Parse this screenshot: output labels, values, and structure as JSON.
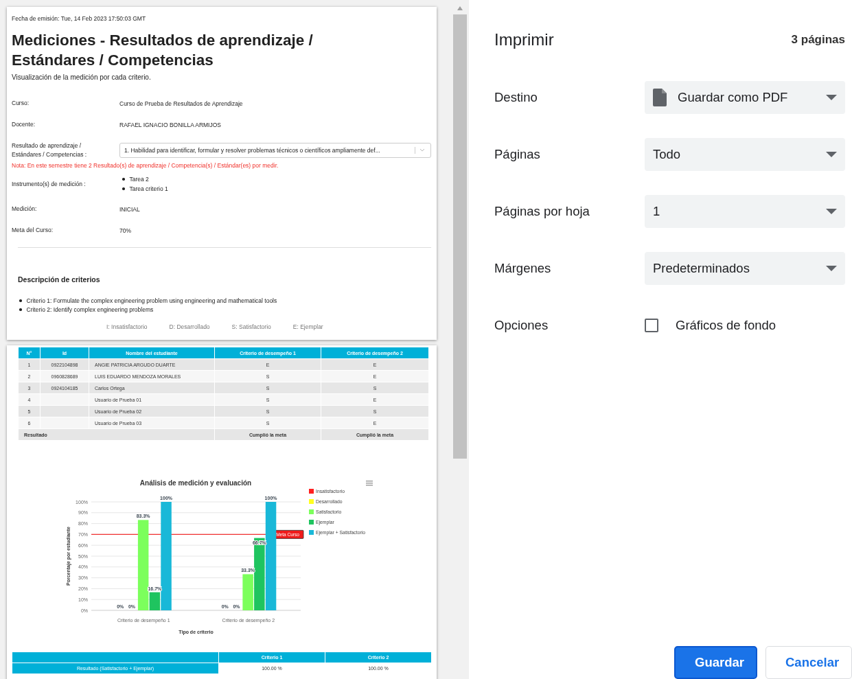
{
  "preview": {
    "page_1": {
      "issue_date": "Fecha de emisión: Tue, 14 Feb 2023 17:50:03 GMT",
      "title": "Mediciones - Resultados de aprendizaje / Estándares / Competencias",
      "subtitle": "Visualización de la medición por cada criterio.",
      "fields": [
        {
          "kind": "text",
          "label": "Curso:",
          "value": "Curso de Prueba de Resultados de Aprendizaje"
        },
        {
          "kind": "text",
          "label": "Docente:",
          "value": "RAFAEL IGNACIO BONILLA ARMIJOS"
        },
        {
          "kind": "select",
          "label": "Resultado de aprendizaje / Estándares / Competencias :",
          "value": "1. Habilidad para identificar, formular y resolver problemas técnicos o científicos ampliamente def..."
        },
        {
          "kind": "note",
          "text": "Nota: En este semestre tiene 2 Resultado(s) de aprendizaje / Competencia(s) / Estándar(es) por medir."
        },
        {
          "kind": "list",
          "label": "Instrumento(s) de medición :",
          "items": [
            "Tarea 2",
            "Tarea criterio 1"
          ]
        },
        {
          "kind": "text",
          "label": "Medición:",
          "value": "INICIAL"
        },
        {
          "kind": "text",
          "label": "Meta del Curso:",
          "value": "70%"
        }
      ],
      "criteria_heading": "Descripción de criterios",
      "criteria": [
        "Criterio 1: Formulate the complex engineering problem using engineering and mathematical tools",
        "Criterio 2: Identify complex engineering problems"
      ],
      "legend": [
        "I: Insatisfactorio",
        "D: Desarrollado",
        "S: Satisfactorio",
        "E: Ejemplar"
      ]
    },
    "page_2": {
      "table": {
        "columns": [
          "N°",
          "Id",
          "Nombre del estudiante",
          "Criterio de desempeño 1",
          "Criterio de desempeño 2"
        ],
        "rows": [
          {
            "cells": [
              "1",
              "0922104898",
              "ANGIE PATRICIA ARGUDO DUARTE",
              "E",
              "E"
            ]
          },
          {
            "cells": [
              "2",
              "0960828689",
              "LUIS EDUARDO MENDOZA MORALES",
              "S",
              "E"
            ]
          },
          {
            "cells": [
              "3",
              "0924104185",
              "Carlos Ortega",
              "S",
              "S"
            ]
          },
          {
            "cells": [
              "4",
              "",
              "Usuario de Prueba 01",
              "S",
              "E"
            ]
          },
          {
            "cells": [
              "5",
              "",
              "Usuario de Prueba 02",
              "S",
              "S"
            ]
          },
          {
            "cells": [
              "6",
              "",
              "Usuario de Prueba 03",
              "S",
              "E"
            ]
          }
        ],
        "footer": [
          "Resultado",
          "Cumplió la meta",
          "Cumplió la meta"
        ]
      },
      "chart_data": {
        "type": "bar",
        "title": "Análisis de medición y evaluación",
        "xlabel": "Tipo de criterio",
        "ylabel": "Porcentaje por estudiante",
        "categories": [
          "Criterio de desempeño 1",
          "Criterio de desempeño 2"
        ],
        "series": [
          {
            "name": "Insatisfactorio",
            "color": "#ff2020",
            "values": [
              0,
              0
            ]
          },
          {
            "name": "Desarrollado",
            "color": "#ffff20",
            "values": [
              0,
              0
            ]
          },
          {
            "name": "Satisfactorio",
            "color": "#7cff5c",
            "values": [
              83.3,
              33.3
            ]
          },
          {
            "name": "Ejemplar",
            "color": "#1fc45f",
            "values": [
              16.7,
              66.7
            ]
          },
          {
            "name": "Ejemplar + Satisfactorio",
            "color": "#19b8d8",
            "values": [
              100,
              100
            ]
          }
        ],
        "ylim": [
          0,
          100
        ],
        "yticks": [
          {
            "value": 0,
            "label": "0%"
          },
          {
            "value": 10,
            "label": "10%"
          },
          {
            "value": 20,
            "label": "20%"
          },
          {
            "value": 30,
            "label": "30%"
          },
          {
            "value": 40,
            "label": "40%"
          },
          {
            "value": 50,
            "label": "50%"
          },
          {
            "value": 60,
            "label": "60%"
          },
          {
            "value": 70,
            "label": "70%"
          },
          {
            "value": 80,
            "label": "80%"
          },
          {
            "value": 90,
            "label": "90%"
          },
          {
            "value": 100,
            "label": "100%"
          }
        ],
        "value_labels": [
          [
            "0%",
            "0%"
          ],
          [
            "0%",
            "0%"
          ],
          [
            "83.3%",
            "33.3%"
          ],
          [
            "16.7%",
            "66.7%"
          ],
          [
            "100%",
            "100%"
          ]
        ],
        "grid": true,
        "legend": "right",
        "ref_lines": [
          {
            "axis": "y",
            "value": 70,
            "label": "Meta Curso",
            "color": "#f03030"
          }
        ]
      },
      "summary": {
        "columns": [
          "Criterio 1",
          "Criterio 2"
        ],
        "rows": [
          {
            "label": "Resultado (Satisfactorio + Ejemplar)",
            "values": [
              "100.00 %",
              "100.00 %"
            ]
          }
        ]
      }
    }
  },
  "print_panel": {
    "title": "Imprimir",
    "page_count": "3 páginas",
    "settings": [
      {
        "kind": "file-select",
        "label": "Destino",
        "value": "Guardar como PDF"
      },
      {
        "kind": "select",
        "label": "Páginas",
        "value": "Todo"
      },
      {
        "kind": "select",
        "label": "Páginas por hoja",
        "value": "1"
      },
      {
        "kind": "select",
        "label": "Márgenes",
        "value": "Predeterminados"
      },
      {
        "kind": "checkbox",
        "label": "Opciones",
        "text": "Gráficos de fondo",
        "checked": false
      }
    ],
    "buttons": [
      {
        "kind": "primary",
        "label": "Guardar"
      },
      {
        "kind": "secondary",
        "label": "Cancelar"
      }
    ]
  }
}
